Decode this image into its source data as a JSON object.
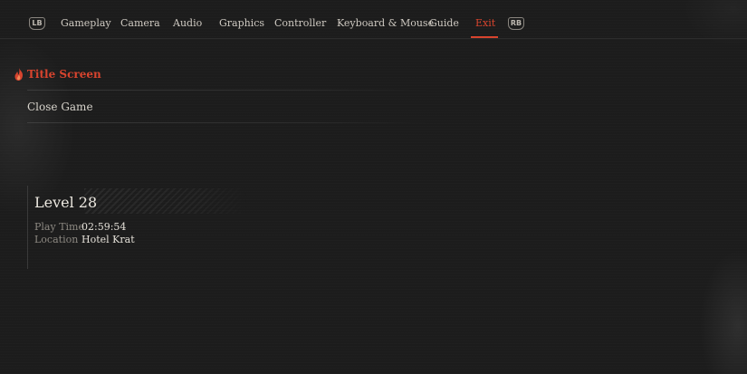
{
  "nav": {
    "left_bumper": "LB",
    "right_bumper": "RB",
    "tabs": [
      {
        "label": "Gameplay"
      },
      {
        "label": "Camera"
      },
      {
        "label": "Audio"
      },
      {
        "label": "Graphics"
      },
      {
        "label": "Controller"
      },
      {
        "label": "Keyboard & Mouse"
      },
      {
        "label": "Guide"
      },
      {
        "label": "Exit"
      }
    ],
    "active_tab": "Exit"
  },
  "menu": {
    "items": [
      {
        "label": "Title Screen",
        "selected": true
      },
      {
        "label": "Close Game",
        "selected": false
      }
    ]
  },
  "save": {
    "title": "Level 28",
    "play_time_label": "Play Time",
    "play_time": "02:59:54",
    "location_label": "Location",
    "location": "Hotel Krat"
  },
  "colors": {
    "accent": "#d8442e",
    "background": "#1c1c1c",
    "text": "#d8d4cc",
    "muted": "#8d8982"
  },
  "icons": {
    "selection_marker": "flame-icon"
  }
}
